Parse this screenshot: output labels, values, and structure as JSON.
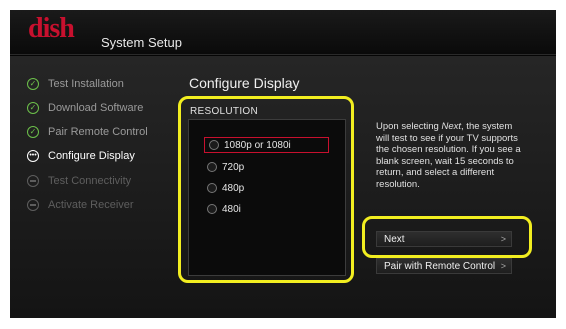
{
  "header": {
    "logo": "dish",
    "title": "System Setup"
  },
  "sidebar": {
    "items": [
      {
        "label": "Test Installation",
        "state": "done",
        "icon": "check-icon"
      },
      {
        "label": "Download Software",
        "state": "done",
        "icon": "check-icon"
      },
      {
        "label": "Pair Remote Control",
        "state": "done",
        "icon": "check-icon"
      },
      {
        "label": "Configure Display",
        "state": "current",
        "icon": "ellipsis-icon"
      },
      {
        "label": "Test Connectivity",
        "state": "pending",
        "icon": "minus-icon"
      },
      {
        "label": "Activate Receiver",
        "state": "pending",
        "icon": "minus-icon"
      }
    ]
  },
  "main": {
    "title": "Configure Display",
    "resolution_label": "RESOLUTION",
    "options": [
      {
        "label": "1080p or 1080i",
        "selected": true
      },
      {
        "label": "720p",
        "selected": false
      },
      {
        "label": "480p",
        "selected": false
      },
      {
        "label": "480i",
        "selected": false
      }
    ],
    "info_prefix": "Upon selecting ",
    "info_emphasis": "Next",
    "info_suffix": ", the system will test to see if your TV supports the chosen resolution. If you see a blank screen, wait 15 seconds to return, and select a different resolution.",
    "next_label": "Next",
    "pair_label": "Pair with Remote Control"
  },
  "colors": {
    "brand": "#c8102e",
    "check": "#6cc04a",
    "highlight": "#f2ee20"
  }
}
